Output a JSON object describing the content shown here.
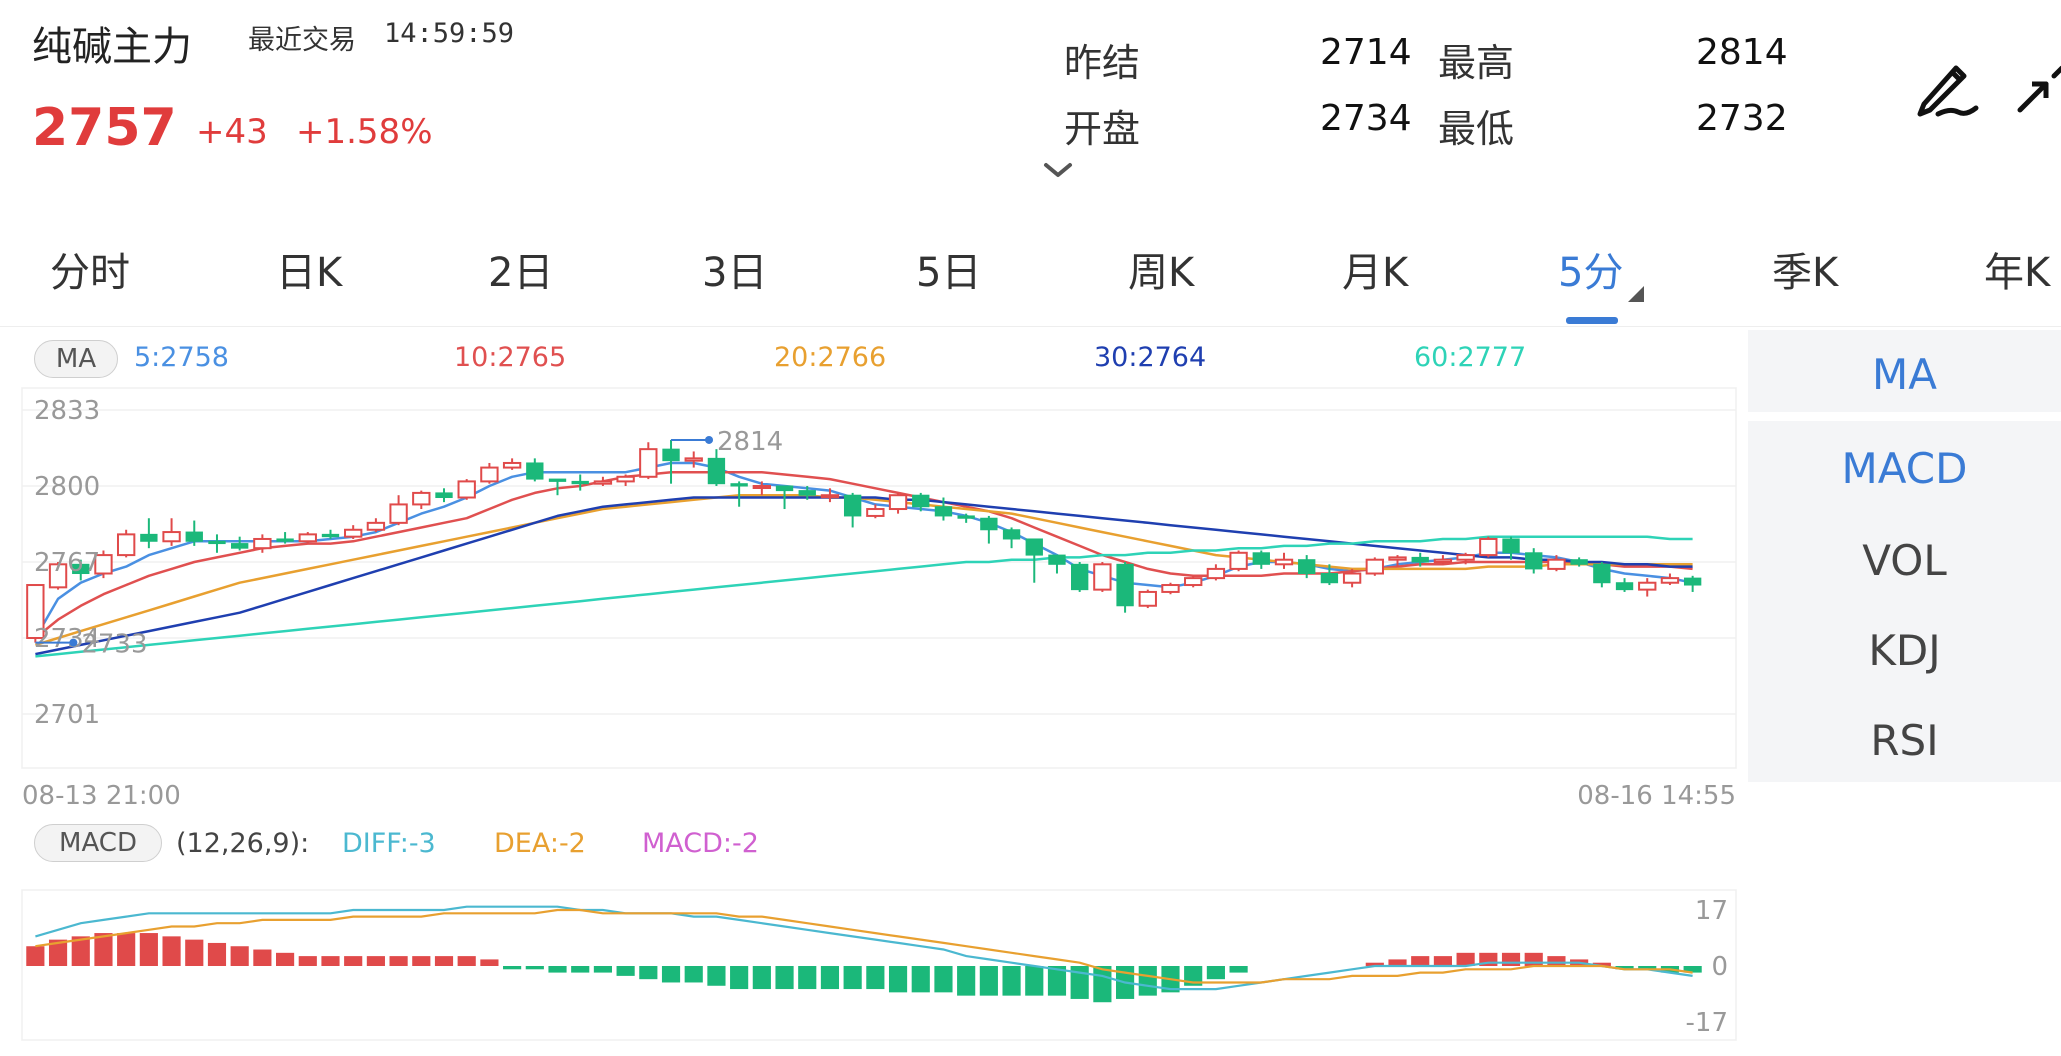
{
  "header": {
    "title": "纯碱主力",
    "last_trade_label": "最近交易",
    "last_trade_time": "14:59:59",
    "price": "2757",
    "change": "+43",
    "change_pct": "+1.58%",
    "quote": {
      "prev_settle_label": "昨结",
      "prev_settle": "2714",
      "high_label": "最高",
      "high": "2814",
      "open_label": "开盘",
      "open": "2734",
      "low_label": "最低",
      "low": "2732"
    },
    "icons": {
      "edit": "pen-icon",
      "fullscreen": "fullscreen-icon",
      "expand": "chevron-down-icon"
    }
  },
  "tabs": [
    {
      "label": "分时"
    },
    {
      "label": "日K"
    },
    {
      "label": "2日"
    },
    {
      "label": "3日"
    },
    {
      "label": "5日"
    },
    {
      "label": "周K"
    },
    {
      "label": "月K"
    },
    {
      "label": "5分",
      "active": true
    },
    {
      "label": "季K"
    },
    {
      "label": "年K"
    }
  ],
  "ma_legend": {
    "pill": "MA",
    "items": [
      {
        "text": "5:2758",
        "color": "#4a90e2"
      },
      {
        "text": "10:2765",
        "color": "#e05050"
      },
      {
        "text": "20:2766",
        "color": "#e8a030"
      },
      {
        "text": "30:2764",
        "color": "#1f3fb0"
      },
      {
        "text": "60:2777",
        "color": "#2ed3b7"
      }
    ]
  },
  "indicators": [
    {
      "label": "MA",
      "active": true
    },
    {
      "label": "MACD",
      "active": true
    },
    {
      "label": "VOL"
    },
    {
      "label": "KDJ"
    },
    {
      "label": "RSI"
    }
  ],
  "macd_legend": {
    "pill": "MACD",
    "params": "(12,26,9):",
    "diff": "DIFF:-3",
    "dea": "DEA:-2",
    "macd": "MACD:-2"
  },
  "colors": {
    "up": "#e04a4a",
    "down": "#1bb87a",
    "accent": "#3a7bd5",
    "diff": "#4bb8d0",
    "dea": "#e8a030",
    "macd": "#d060d0"
  },
  "chart_data": [
    {
      "type": "candlestick",
      "y_labels": [
        "2833",
        "2800",
        "2767",
        "2734",
        "2701"
      ],
      "ylim": [
        2701,
        2833
      ],
      "x_start_label": "08-13 21:00",
      "x_end_label": "08-16 14:55",
      "annotations": {
        "high_text": "2814",
        "low_text": "2733"
      },
      "candles": [
        [
          2734,
          2757,
          2757,
          2732
        ],
        [
          2756,
          2766,
          2767,
          2755
        ],
        [
          2766,
          2762,
          2768,
          2759
        ],
        [
          2762,
          2770,
          2772,
          2760
        ],
        [
          2770,
          2779,
          2781,
          2769
        ],
        [
          2779,
          2776,
          2786,
          2773
        ],
        [
          2776,
          2780,
          2786,
          2774
        ],
        [
          2780,
          2776,
          2785,
          2774
        ],
        [
          2776,
          2775,
          2779,
          2771
        ],
        [
          2775,
          2773,
          2778,
          2772
        ],
        [
          2773,
          2777,
          2779,
          2771
        ],
        [
          2777,
          2776,
          2780,
          2775
        ],
        [
          2776,
          2779,
          2780,
          2775
        ],
        [
          2779,
          2778,
          2781,
          2777
        ],
        [
          2778,
          2781,
          2783,
          2777
        ],
        [
          2781,
          2784,
          2786,
          2780
        ],
        [
          2784,
          2792,
          2796,
          2783
        ],
        [
          2792,
          2797,
          2798,
          2790
        ],
        [
          2797,
          2795,
          2799,
          2793
        ],
        [
          2795,
          2802,
          2803,
          2794
        ],
        [
          2802,
          2808,
          2810,
          2801
        ],
        [
          2808,
          2810,
          2812,
          2807
        ],
        [
          2810,
          2803,
          2812,
          2802
        ],
        [
          2803,
          2802,
          2803,
          2796
        ],
        [
          2802,
          2801,
          2805,
          2798
        ],
        [
          2801,
          2802,
          2804,
          2800
        ],
        [
          2802,
          2804,
          2805,
          2800
        ],
        [
          2804,
          2816,
          2819,
          2803
        ],
        [
          2816,
          2811,
          2820,
          2801
        ],
        [
          2811,
          2812,
          2815,
          2808
        ],
        [
          2812,
          2801,
          2816,
          2800
        ],
        [
          2801,
          2800,
          2802,
          2791
        ],
        [
          2800,
          2800,
          2802,
          2796
        ],
        [
          2800,
          2798,
          2799,
          2790
        ],
        [
          2798,
          2796,
          2800,
          2794
        ],
        [
          2796,
          2796,
          2799,
          2793
        ],
        [
          2796,
          2787,
          2797,
          2782
        ],
        [
          2787,
          2790,
          2792,
          2786
        ],
        [
          2790,
          2796,
          2797,
          2788
        ],
        [
          2796,
          2791,
          2797,
          2789
        ],
        [
          2791,
          2787,
          2795,
          2785
        ],
        [
          2787,
          2786,
          2788,
          2784
        ],
        [
          2786,
          2781,
          2787,
          2775
        ],
        [
          2781,
          2777,
          2782,
          2773
        ],
        [
          2777,
          2770,
          2776,
          2758
        ],
        [
          2770,
          2766,
          2768,
          2762
        ],
        [
          2766,
          2755,
          2767,
          2754
        ],
        [
          2755,
          2766,
          2767,
          2754
        ],
        [
          2766,
          2748,
          2767,
          2745
        ],
        [
          2748,
          2754,
          2755,
          2747
        ],
        [
          2754,
          2757,
          2758,
          2753
        ],
        [
          2757,
          2760,
          2761,
          2756
        ],
        [
          2760,
          2764,
          2766,
          2759
        ],
        [
          2764,
          2771,
          2772,
          2763
        ],
        [
          2771,
          2766,
          2772,
          2764
        ],
        [
          2766,
          2768,
          2771,
          2764
        ],
        [
          2768,
          2762,
          2770,
          2760
        ],
        [
          2762,
          2758,
          2766,
          2757
        ],
        [
          2758,
          2762,
          2764,
          2756
        ],
        [
          2762,
          2768,
          2769,
          2761
        ],
        [
          2768,
          2769,
          2770,
          2765
        ],
        [
          2769,
          2767,
          2771,
          2765
        ],
        [
          2767,
          2768,
          2770,
          2766
        ],
        [
          2768,
          2770,
          2771,
          2766
        ],
        [
          2770,
          2777,
          2778,
          2769
        ],
        [
          2777,
          2771,
          2778,
          2768
        ],
        [
          2771,
          2764,
          2773,
          2762
        ],
        [
          2764,
          2768,
          2770,
          2763
        ],
        [
          2768,
          2766,
          2769,
          2765
        ],
        [
          2766,
          2758,
          2767,
          2756
        ],
        [
          2758,
          2755,
          2760,
          2754
        ],
        [
          2755,
          2758,
          2760,
          2752
        ],
        [
          2758,
          2760,
          2762,
          2757
        ],
        [
          2760,
          2757,
          2761,
          2754
        ]
      ],
      "series": [
        {
          "name": "MA5",
          "color": "#4a90e2",
          "values": [
            2734,
            2751,
            2758,
            2762,
            2765,
            2770,
            2773,
            2776,
            2776,
            2776,
            2776,
            2776,
            2776,
            2777,
            2778,
            2780,
            2784,
            2788,
            2791,
            2795,
            2800,
            2804,
            2806,
            2806,
            2806,
            2806,
            2806,
            2808,
            2810,
            2810,
            2808,
            2804,
            2801,
            2800,
            2799,
            2798,
            2795,
            2792,
            2791,
            2790,
            2789,
            2787,
            2784,
            2780,
            2775,
            2770,
            2764,
            2761,
            2758,
            2757,
            2756,
            2758,
            2761,
            2765,
            2767,
            2767,
            2766,
            2764,
            2763,
            2764,
            2766,
            2767,
            2768,
            2769,
            2771,
            2771,
            2770,
            2769,
            2767,
            2764,
            2762,
            2761,
            2760,
            2758
          ]
        },
        {
          "name": "MA10",
          "color": "#e05050",
          "values": [
            2734,
            2742,
            2748,
            2753,
            2757,
            2761,
            2764,
            2767,
            2769,
            2771,
            2773,
            2774,
            2775,
            2775,
            2776,
            2778,
            2780,
            2782,
            2784,
            2786,
            2790,
            2794,
            2797,
            2799,
            2800,
            2802,
            2804,
            2805,
            2806,
            2806,
            2806,
            2806,
            2806,
            2805,
            2804,
            2803,
            2801,
            2799,
            2797,
            2795,
            2793,
            2791,
            2789,
            2786,
            2782,
            2778,
            2774,
            2770,
            2767,
            2764,
            2762,
            2761,
            2761,
            2761,
            2761,
            2762,
            2762,
            2762,
            2763,
            2764,
            2765,
            2766,
            2766,
            2767,
            2767,
            2767,
            2767,
            2767,
            2766,
            2766,
            2765,
            2765,
            2765,
            2764
          ]
        },
        {
          "name": "MA20",
          "color": "#e8a030",
          "values": [
            2731,
            2734,
            2737,
            2740,
            2743,
            2746,
            2749,
            2752,
            2755,
            2758,
            2760,
            2762,
            2764,
            2766,
            2768,
            2770,
            2772,
            2774,
            2776,
            2778,
            2780,
            2782,
            2784,
            2786,
            2788,
            2790,
            2791,
            2792,
            2793,
            2794,
            2795,
            2796,
            2796,
            2796,
            2796,
            2795,
            2795,
            2794,
            2793,
            2792,
            2791,
            2790,
            2789,
            2788,
            2786,
            2784,
            2782,
            2780,
            2778,
            2776,
            2774,
            2772,
            2770,
            2769,
            2768,
            2767,
            2766,
            2765,
            2764,
            2764,
            2764,
            2764,
            2764,
            2764,
            2765,
            2765,
            2765,
            2766,
            2766,
            2766,
            2766,
            2766,
            2766,
            2766
          ]
        },
        {
          "name": "MA30",
          "color": "#1f3fb0",
          "values": [
            2727,
            2729,
            2731,
            2733,
            2735,
            2737,
            2739,
            2741,
            2743,
            2745,
            2748,
            2751,
            2754,
            2757,
            2760,
            2763,
            2766,
            2769,
            2772,
            2775,
            2778,
            2781,
            2784,
            2787,
            2789,
            2791,
            2792,
            2793,
            2794,
            2795,
            2795,
            2795,
            2795,
            2795,
            2795,
            2795,
            2795,
            2795,
            2794,
            2794,
            2793,
            2792,
            2791,
            2790,
            2789,
            2788,
            2787,
            2786,
            2785,
            2784,
            2783,
            2782,
            2781,
            2780,
            2779,
            2778,
            2777,
            2776,
            2775,
            2774,
            2773,
            2772,
            2771,
            2770,
            2769,
            2769,
            2768,
            2768,
            2767,
            2767,
            2766,
            2766,
            2765,
            2765
          ]
        },
        {
          "name": "MA60",
          "color": "#2ed3b7",
          "values": [
            2726,
            2727,
            2728,
            2729,
            2730,
            2731,
            2732,
            2733,
            2734,
            2735,
            2736,
            2737,
            2738,
            2739,
            2740,
            2741,
            2742,
            2743,
            2744,
            2745,
            2746,
            2747,
            2748,
            2749,
            2750,
            2751,
            2752,
            2753,
            2754,
            2755,
            2756,
            2757,
            2758,
            2759,
            2760,
            2761,
            2762,
            2763,
            2764,
            2765,
            2766,
            2767,
            2767,
            2768,
            2768,
            2769,
            2769,
            2770,
            2770,
            2771,
            2771,
            2772,
            2772,
            2773,
            2773,
            2774,
            2774,
            2775,
            2775,
            2776,
            2776,
            2776,
            2777,
            2777,
            2778,
            2778,
            2778,
            2778,
            2778,
            2778,
            2778,
            2778,
            2777,
            2777
          ]
        }
      ]
    },
    {
      "type": "macd",
      "y_labels": [
        "17",
        "0",
        "-17"
      ],
      "ylim": [
        -17,
        17
      ],
      "diff": [
        9,
        11,
        13,
        14,
        15,
        16,
        16,
        16,
        16,
        16,
        16,
        16,
        16,
        16,
        17,
        17,
        17,
        17,
        17,
        18,
        18,
        18,
        18,
        18,
        17,
        17,
        16,
        16,
        16,
        15,
        15,
        14,
        13,
        12,
        11,
        10,
        9,
        8,
        7,
        6,
        5,
        3,
        2,
        1,
        0,
        -1,
        -2,
        -3,
        -5,
        -6,
        -7,
        -7,
        -7,
        -6,
        -5,
        -4,
        -3,
        -2,
        -1,
        0,
        0,
        0,
        0,
        0,
        1,
        1,
        1,
        1,
        1,
        0,
        -1,
        -1,
        -2,
        -3
      ],
      "dea": [
        6,
        7,
        8,
        9,
        10,
        11,
        12,
        12,
        13,
        13,
        14,
        14,
        14,
        14,
        15,
        15,
        15,
        15,
        16,
        16,
        16,
        16,
        16,
        17,
        17,
        16,
        16,
        16,
        16,
        16,
        16,
        15,
        15,
        14,
        13,
        12,
        11,
        10,
        9,
        8,
        7,
        6,
        5,
        4,
        3,
        2,
        1,
        -1,
        -2,
        -3,
        -4,
        -5,
        -5,
        -5,
        -5,
        -4,
        -4,
        -4,
        -3,
        -3,
        -3,
        -2,
        -2,
        -1,
        -1,
        -1,
        0,
        0,
        0,
        0,
        -1,
        -1,
        -1,
        -2
      ],
      "macd": [
        6,
        8,
        9,
        10,
        10,
        10,
        9,
        8,
        7,
        6,
        5,
        4,
        3,
        3,
        3,
        3,
        3,
        3,
        3,
        3,
        2,
        -1,
        -1,
        -2,
        -2,
        -2,
        -3,
        -4,
        -5,
        -5,
        -6,
        -7,
        -7,
        -7,
        -7,
        -7,
        -7,
        -7,
        -8,
        -8,
        -8,
        -9,
        -9,
        -9,
        -9,
        -9,
        -10,
        -11,
        -10,
        -9,
        -8,
        -6,
        -4,
        -2,
        0,
        0,
        0,
        0,
        0,
        1,
        2,
        3,
        3,
        4,
        4,
        4,
        4,
        3,
        2,
        1,
        -1,
        -1,
        -2,
        -2
      ]
    }
  ]
}
